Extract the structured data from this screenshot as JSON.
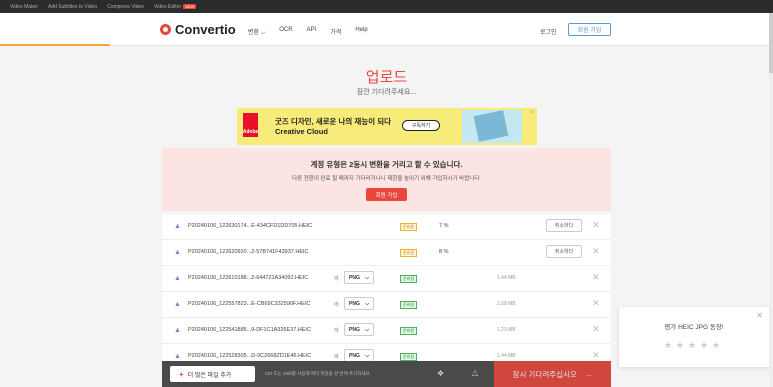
{
  "topbar": {
    "links": [
      "Video Maker",
      "Add Subtitles to Video",
      "Compress Video",
      "Video Editor"
    ],
    "new_badge": "NEW"
  },
  "header": {
    "logo": "Convertio",
    "nav": [
      "변환 ⌵",
      "OCR",
      "API",
      "가격",
      "Help"
    ],
    "login": "로그인",
    "signup": "회원 가입"
  },
  "main": {
    "title": "업로드",
    "subtitle": "잠깐 기다려주세요..."
  },
  "ad": {
    "brand": "Adobe",
    "line1": "굿즈 디자인, 새로운 나의 재능이 되다",
    "line2": "Creative Cloud",
    "button": "구독하기"
  },
  "notice": {
    "title": "계정 유형은 2동시 변환을 거리고 할 수 있습니다.",
    "text": "다른 전환이 완료 될 때까지 기다리거나니 제한을 높이기 위해 가입하시기 바랍니다.",
    "button": "회원 가입"
  },
  "files": [
    {
      "name": "P20240106_122630174...E-434CFD1DD705.HEIC",
      "status": "준비중",
      "status_type": "wait",
      "progress": "7 %",
      "cancel": "취소하다"
    },
    {
      "name": "P20240106_122620920...2-57B741F43937.HEIC",
      "status": "준비중",
      "status_type": "wait",
      "progress": "8 %",
      "cancel": "취소하다"
    },
    {
      "name": "P20240106_122610188...2-644721A34092.HEIC",
      "to": "에",
      "format": "PNG",
      "status": "준비됨",
      "status_type": "ready",
      "size": "1.44 MB"
    },
    {
      "name": "P20240106_122557823...E-CB69C332590F.HEIC",
      "to": "에",
      "format": "PNG",
      "status": "준비됨",
      "status_type": "ready",
      "size": "1.58 MB"
    },
    {
      "name": "P20240106_122541885...9-DF1C1A326E37.HEIC",
      "to": "에",
      "format": "PNG",
      "status": "준비됨",
      "status_type": "ready",
      "size": "1.23 MB"
    },
    {
      "name": "P20240106_122528305...D-0C2668ZD1E46.HEIC",
      "to": "에",
      "format": "PNG",
      "status": "준비됨",
      "status_type": "ready",
      "size": "1.44 MB"
    }
  ],
  "footer": {
    "add_button": "더 많은 파일 추가",
    "hint": "Ctrl 또는 Shift를 사용해 여러 파일을 한 번에 추가하세요.",
    "convert_button": "잠시 기다려주십시오",
    "convert_arrow": "→"
  },
  "rating": {
    "title": "평가 HEIC JPG 동장!",
    "stars": "★★★★★"
  },
  "icons": {
    "file": "image-file-icon",
    "close": "close-icon",
    "dropbox": "dropbox-icon",
    "gdrive": "google-drive-icon"
  },
  "colors": {
    "accent": "#e8473c",
    "link": "#5b9bd5",
    "ready": "#49b35b",
    "wait": "#f2b134"
  }
}
